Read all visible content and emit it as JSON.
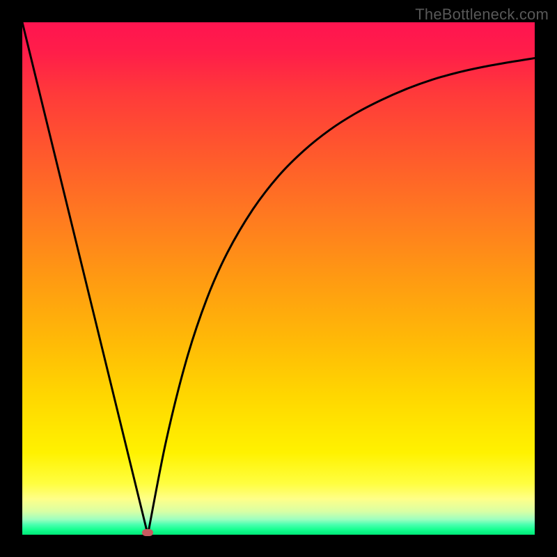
{
  "watermark": "TheBottleneck.com",
  "chart_data": {
    "type": "line",
    "title": "",
    "xlabel": "",
    "ylabel": "",
    "xlim": [
      0,
      100
    ],
    "ylim": [
      0,
      100
    ],
    "minimum_point": {
      "x": 24.5,
      "y": 0
    },
    "series": [
      {
        "name": "curve",
        "x": [
          0,
          5,
          10,
          15,
          20,
          24.5,
          28,
          32,
          36,
          40,
          45,
          50,
          55,
          60,
          65,
          70,
          75,
          80,
          85,
          90,
          95,
          100
        ],
        "values": [
          100,
          79.6,
          59.2,
          38.8,
          18.4,
          0.0,
          18.0,
          34.0,
          46.0,
          55.0,
          63.5,
          70.0,
          75.0,
          79.0,
          82.2,
          84.8,
          87.0,
          88.8,
          90.2,
          91.3,
          92.2,
          93.0
        ]
      }
    ],
    "gradient_stops": [
      {
        "pos": 0,
        "color": "#ff1450"
      },
      {
        "pos": 0.5,
        "color": "#ff9a12"
      },
      {
        "pos": 0.84,
        "color": "#fff200"
      },
      {
        "pos": 1.0,
        "color": "#00e878"
      }
    ]
  }
}
